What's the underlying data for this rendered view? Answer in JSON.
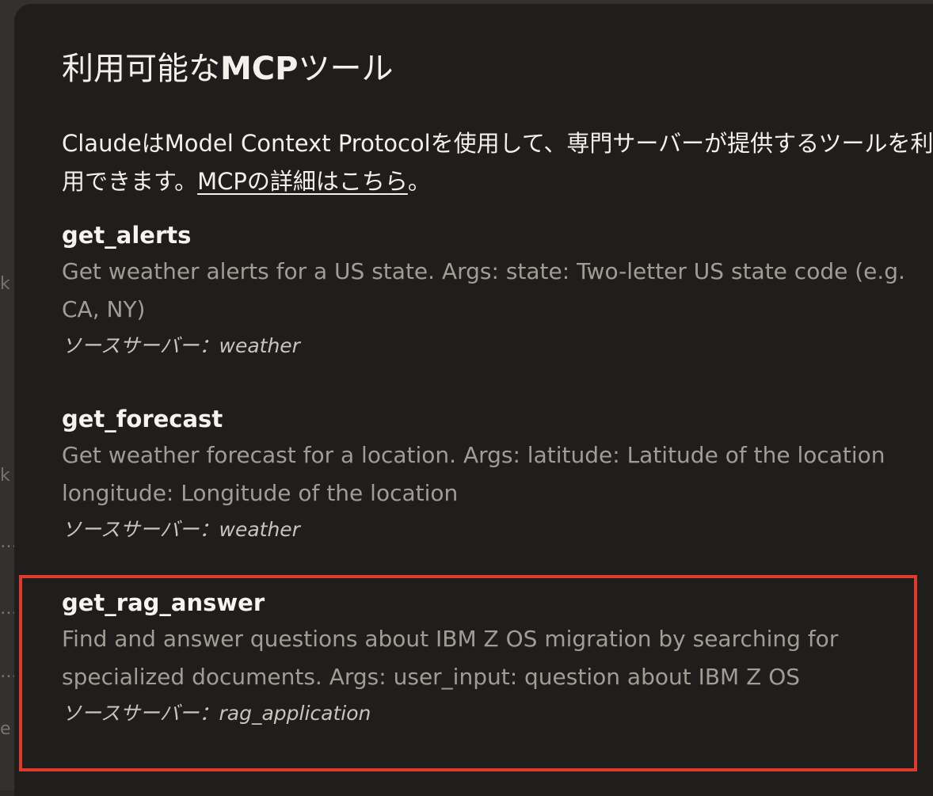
{
  "dialog": {
    "title_prefix": "利用可能な",
    "title_mcp": "MCP",
    "title_suffix": "ツール",
    "intro_text": "ClaudeはModel Context Protocolを使用して、専門サーバーが提供するツールを利用できます。",
    "intro_link": "MCPの詳細はこちら",
    "intro_end": "。"
  },
  "background_edge": [
    "k",
    "k",
    "…",
    "…",
    "…",
    "e"
  ],
  "tools": [
    {
      "name": "get_alerts",
      "description": "Get weather alerts for a US state. Args: state: Two-letter US state code (e.g. CA, NY)",
      "source": "ソースサーバー：weather"
    },
    {
      "name": "get_forecast",
      "description": "Get weather forecast for a location. Args: latitude: Latitude of the location longitude: Longitude of the location",
      "source": "ソースサーバー：weather"
    },
    {
      "name": "get_rag_answer",
      "description": "Find and answer questions about IBM Z OS migration by searching for specialized documents. Args: user_input: question about IBM Z OS",
      "source": "ソースサーバー：rag_application"
    }
  ],
  "colors": {
    "dialog_bg": "#1f1e1d",
    "highlight": "#e03a2c",
    "muted_text": "#a19d95"
  }
}
